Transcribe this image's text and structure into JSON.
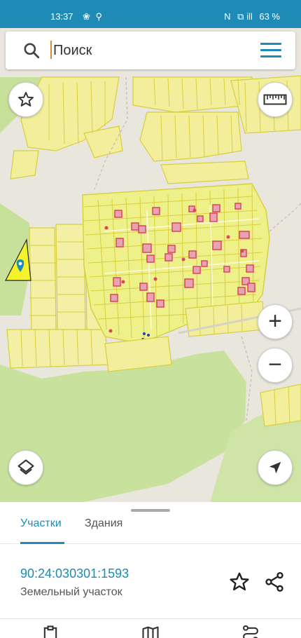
{
  "status_bar": {
    "time": "13:37",
    "notifications": "❀ ⚲",
    "network": "N",
    "signal": "⧉ ill",
    "battery": "63 %"
  },
  "search": {
    "placeholder": "Поиск",
    "icon": "search-icon",
    "menu_icon": "menu-icon"
  },
  "map_controls": {
    "favorite_icon": "star-outline-icon",
    "ruler_icon": "ruler-icon",
    "layers_icon": "layers-icon",
    "zoom_in_label": "+",
    "zoom_out_label": "−",
    "location_icon": "navigation-arrow-icon"
  },
  "colors": {
    "accent": "#1e8bb7",
    "parcel_fill": "#f2ee9b",
    "parcel_stroke": "#d7cf3b",
    "building_stroke": "#d9465d",
    "green_area": "#c7e19b",
    "selected_parcel": "#f4f22a"
  },
  "tabs": [
    {
      "label": "Участки",
      "active": true
    },
    {
      "label": "Здания",
      "active": false
    }
  ],
  "parcel": {
    "number": "90:24:030301:1593",
    "type": "Земельный участок"
  },
  "bottom_nav": [
    {
      "icon": "clipboard-icon"
    },
    {
      "icon": "map-icon"
    },
    {
      "icon": "route-icon"
    }
  ]
}
